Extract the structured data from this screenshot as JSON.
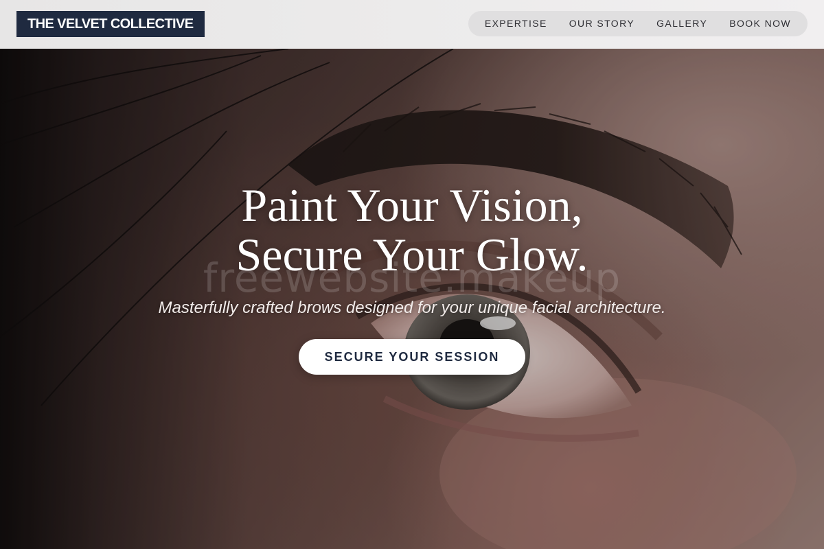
{
  "header": {
    "brand": "THE VELVET COLLECTIVE",
    "nav": [
      {
        "label": "EXPERTISE"
      },
      {
        "label": "OUR STORY"
      },
      {
        "label": "GALLERY"
      },
      {
        "label": "BOOK NOW"
      }
    ]
  },
  "hero": {
    "headline_line1": "Paint Your Vision,",
    "headline_line2": "Secure Your Glow.",
    "subheadline": "Masterfully crafted brows designed for your unique facial architecture.",
    "cta_label": "SECURE YOUR SESSION",
    "watermark": "freewebsite.makeup"
  },
  "colors": {
    "brand_navy": "#1f2a40",
    "header_bg": "#ebeaea",
    "nav_pill_bg": "#e0dfe0",
    "cta_bg": "#ffffff"
  }
}
